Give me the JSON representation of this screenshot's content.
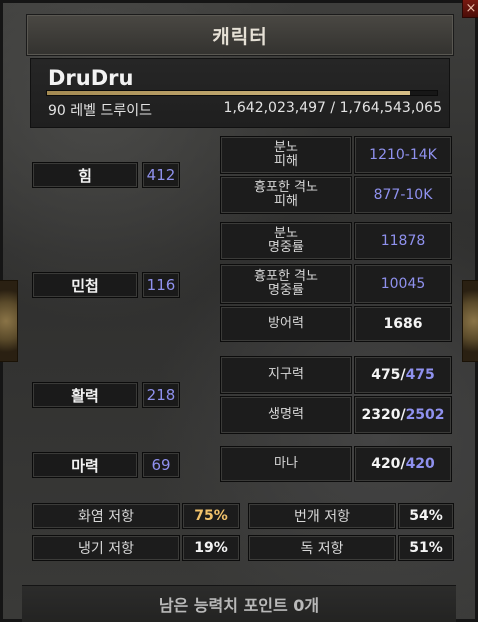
{
  "window": {
    "title": "캐릭터",
    "close_icon": "×"
  },
  "character": {
    "name": "DruDru",
    "level_class": "90 레벨 드루이드",
    "experience_text": "1,642,023,497 / 1,764,543,065",
    "experience_fraction": 0.93
  },
  "attributes": [
    {
      "label": "힘",
      "value": "412"
    },
    {
      "label": "민첩",
      "value": "116"
    },
    {
      "label": "활력",
      "value": "218"
    },
    {
      "label": "마력",
      "value": "69"
    }
  ],
  "combat": {
    "rage_damage": {
      "label": "분노\n피해",
      "value": "1210-14K"
    },
    "fury_damage": {
      "label": "흉포한 격노\n피해",
      "value": "877-10K"
    },
    "rage_hit": {
      "label": "분노\n명중률",
      "value": "11878"
    },
    "fury_hit": {
      "label": "흉포한 격노\n명중률",
      "value": "10045"
    },
    "defense": {
      "label": "방어력",
      "value": "1686"
    },
    "stamina": {
      "label": "지구력",
      "current": "475",
      "max": "475"
    },
    "life": {
      "label": "생명력",
      "current": "2320",
      "max": "2502"
    },
    "mana": {
      "label": "마나",
      "current": "420",
      "max": "420"
    }
  },
  "separator": "/",
  "resistances": [
    {
      "label": "화염 저항",
      "value": "75%"
    },
    {
      "label": "번개 저항",
      "value": "54%"
    },
    {
      "label": "냉기 저항",
      "value": "19%"
    },
    {
      "label": "독 저항",
      "value": "51%"
    }
  ],
  "remaining_points": "남은 능력치 포인트 0개",
  "colors": {
    "stat_blue": "#8f91ee",
    "fire_yellow": "#f1c26b",
    "gold": "#d7bf86"
  }
}
